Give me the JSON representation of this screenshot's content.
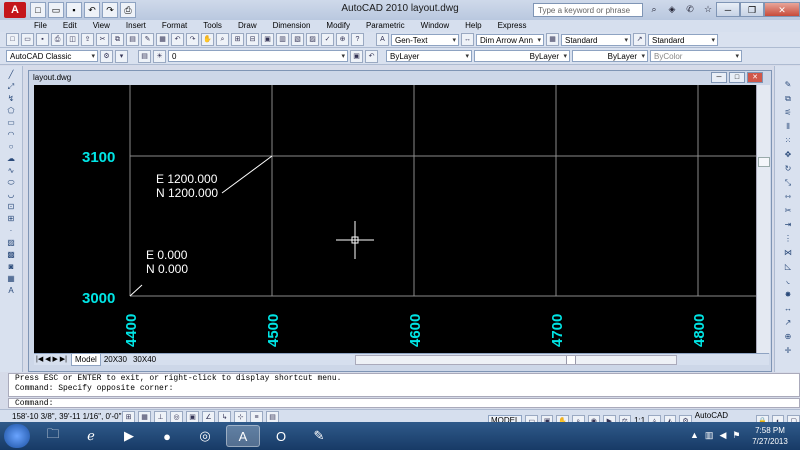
{
  "titlebar": {
    "title": "AutoCAD 2010     layout.dwg",
    "search_placeholder": "Type a keyword or phrase",
    "minimize": "─",
    "restore": "❐",
    "close": "✕"
  },
  "menu": [
    "File",
    "Edit",
    "View",
    "Insert",
    "Format",
    "Tools",
    "Draw",
    "Dimension",
    "Modify",
    "Parametric",
    "Window",
    "Help",
    "Express"
  ],
  "toolbar2": {
    "text_style": "Gen-Text",
    "dim_style": "Dim Arrow Ann",
    "table_style": "Standard",
    "mleader_style": "Standard"
  },
  "toolbar3": {
    "workspace": "AutoCAD Classic",
    "layer": "0",
    "color": "ByLayer",
    "linetype": "ByLayer",
    "lineweight": "ByLayer",
    "plotstyle": "ByColor"
  },
  "document": {
    "title": "layout.dwg"
  },
  "drawing": {
    "y_labels": [
      "3100",
      "3000"
    ],
    "x_labels": [
      "4400",
      "4500",
      "4600",
      "4700",
      "4800"
    ],
    "label_color": "#00e5e5",
    "point_upper": {
      "e": "E 1200.000",
      "n": "N 1200.000"
    },
    "point_lower": {
      "e": "E 0.000",
      "n": "N 0.000"
    }
  },
  "layout_tabs": {
    "nav": "|◀ ◀ ▶ ▶|",
    "tabs": [
      "Model",
      "20X30",
      "30X40"
    ]
  },
  "command": {
    "history": [
      "Press ESC or ENTER to exit, or right-click to display shortcut menu.",
      "Command: Specify opposite corner:"
    ],
    "prompt": "Command:"
  },
  "status": {
    "coords": "158'-10 3/8\", 39'-11 1/16\", 0'-0\"",
    "model": "MODEL",
    "scale": "1:1",
    "workspace": "AutoCAD Classic"
  },
  "taskbar": {
    "time": "7:58 PM",
    "date": "7/27/2013"
  }
}
